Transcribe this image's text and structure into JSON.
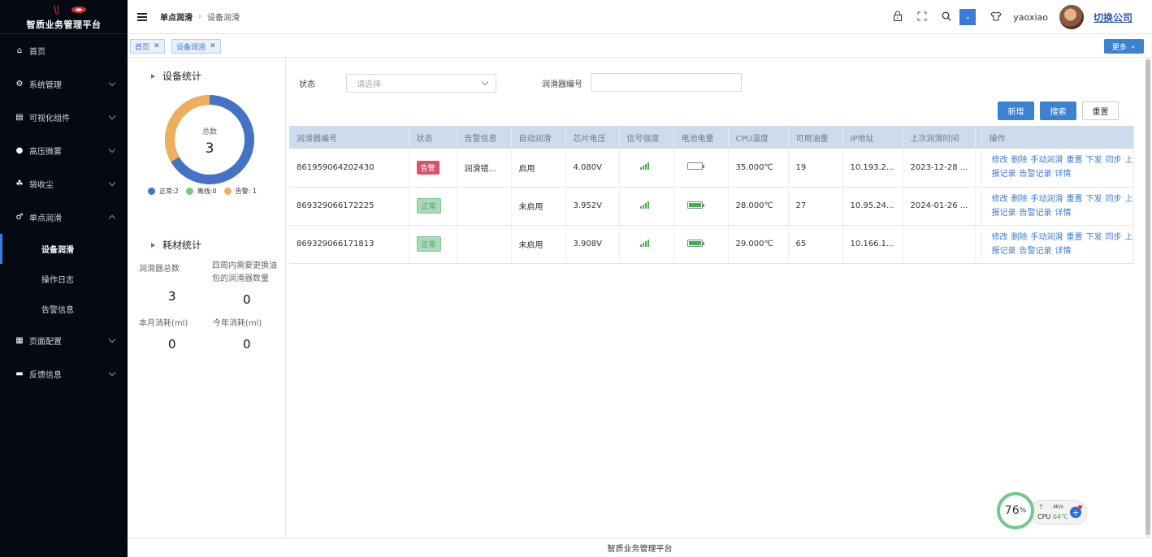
{
  "app": {
    "title": "智质业务管理平台"
  },
  "sidebar": {
    "items": [
      {
        "label": "首页",
        "icon": "home-icon",
        "chevron": false
      },
      {
        "label": "系统管理",
        "icon": "gear-icon",
        "chevron": true
      },
      {
        "label": "可视化组件",
        "icon": "chart-icon",
        "chevron": true
      },
      {
        "label": "高压微雾",
        "icon": "mist-icon",
        "chevron": true
      },
      {
        "label": "袋收尘",
        "icon": "dust-icon",
        "chevron": true
      },
      {
        "label": "单点润滑",
        "icon": "lubricate-icon",
        "chevron": true,
        "expanded": true
      },
      {
        "label": "页面配置",
        "icon": "page-config-icon",
        "chevron": true
      },
      {
        "label": "反馈信息",
        "icon": "feedback-icon",
        "chevron": true
      }
    ],
    "subitems": [
      {
        "label": "设备润滑",
        "active": true
      },
      {
        "label": "操作日志",
        "active": false
      },
      {
        "label": "告警信息",
        "active": false
      }
    ]
  },
  "header": {
    "breadcrumb": [
      "单点润滑",
      "设备润滑"
    ],
    "username": "yaoxiao",
    "switch_label": "切换公司"
  },
  "tabs": [
    {
      "label": "首页"
    },
    {
      "label": "设备润滑"
    }
  ],
  "more_label": "更多",
  "device_stats": {
    "title": "设备统计",
    "total_label": "总数",
    "total_value": "3",
    "legend": [
      {
        "label": "正常:2",
        "color": "#4472c4"
      },
      {
        "label": "离线:0",
        "color": "#7bc77e"
      },
      {
        "label": "告警: 1",
        "color": "#f0ad5d"
      }
    ]
  },
  "consumable_stats": {
    "title": "耗材统计",
    "total_label": "润滑器总数",
    "total_value": "3",
    "replace_label": "四周内需要更换油包的润滑器数量",
    "replace_value": "0",
    "month_label": "本月消耗(ml)",
    "month_value": "0",
    "year_label": "今年消耗(ml)",
    "year_value": "0"
  },
  "filters": {
    "status_label": "状态",
    "status_placeholder": "请选择",
    "code_label": "润滑器编号"
  },
  "buttons": {
    "add": "新增",
    "search": "搜索",
    "reset": "重置"
  },
  "table": {
    "headers": [
      "润滑器编号",
      "状态",
      "告警信息",
      "自动润滑",
      "芯片电压",
      "信号强度",
      "电池电量",
      "CPU温度",
      "可用油量",
      "IP地址",
      "上次润滑时间",
      "",
      "操作"
    ],
    "ops": [
      "修改",
      "删除",
      "手动润滑",
      "重置",
      "下发",
      "同步",
      "上报记录",
      "告警记录",
      "详情"
    ],
    "rows": [
      {
        "id": "861959064202430",
        "status": "告警",
        "status_type": "alarm",
        "alarm": "润滑错...",
        "auto": "启用",
        "voltage": "4.080V",
        "battery_level": 0,
        "cpu": "35.000℃",
        "oil": "19",
        "ip": "10.193.2...",
        "last": "2023-12-28 ..."
      },
      {
        "id": "869329066172225",
        "status": "正常",
        "status_type": "ok",
        "alarm": "",
        "auto": "未启用",
        "voltage": "3.952V",
        "battery_level": 100,
        "cpu": "28.000℃",
        "oil": "27",
        "ip": "10.95.24...",
        "last": "2024-01-26 ..."
      },
      {
        "id": "869329066171813",
        "status": "正常",
        "status_type": "ok",
        "alarm": "",
        "auto": "未启用",
        "voltage": "3.908V",
        "battery_level": 100,
        "cpu": "29.000℃",
        "oil": "65",
        "ip": "10.166.1...",
        "last": ""
      }
    ]
  },
  "footer": "智质业务管理平台",
  "cpu_widget": {
    "percent": "76",
    "percent_sign": "%",
    "speed": "4K/s",
    "cpu_label": "CPU",
    "temp": "64℃"
  }
}
